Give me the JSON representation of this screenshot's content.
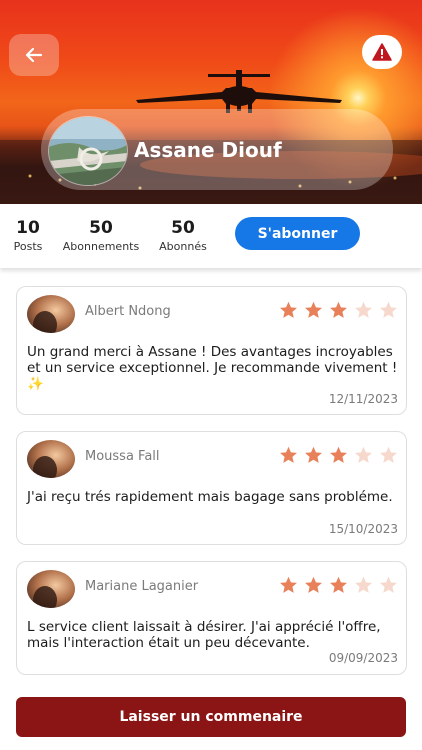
{
  "header": {
    "back_icon": "arrow-left-icon",
    "report_icon": "warning-triangle-icon",
    "report_color": "#c0161f"
  },
  "profile": {
    "name": "Assane Diouf"
  },
  "stats": {
    "posts": {
      "value": "10",
      "label": "Posts"
    },
    "following": {
      "value": "50",
      "label": "Abonnements"
    },
    "followers": {
      "value": "50",
      "label": "Abonnés"
    },
    "subscribe_label": "S'abonner"
  },
  "reviews": [
    {
      "author": "Albert Ndong",
      "rating": 3,
      "max_rating": 5,
      "text": "Un grand merci à Assane ! Des avantages incroyables et un service exceptionnel. Je recommande vivement ! ✨",
      "date": "12/11/2023"
    },
    {
      "author": "Moussa Fall",
      "rating": 3,
      "max_rating": 5,
      "text": "J'ai reçu trés rapidement mais bagage sans probléme.",
      "date": "15/10/2023"
    },
    {
      "author": "Mariane Laganier",
      "rating": 3,
      "max_rating": 5,
      "text": " L service client laissait à désirer. J'ai apprécié l'offre, mais l'interaction était un peu décevante.",
      "date": "09/09/2023"
    }
  ],
  "comment_button_label": "Laisser un commenaire",
  "colors": {
    "star_filled": "#e8805a",
    "star_empty": "#f6d9cc",
    "subscribe": "#1677e6",
    "comment_button": "#8b1414"
  }
}
